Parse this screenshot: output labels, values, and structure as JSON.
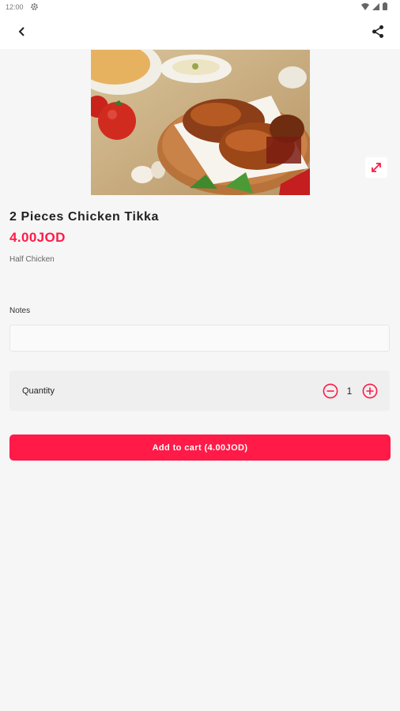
{
  "status_bar": {
    "time": "12:00",
    "icons": [
      "gear-icon",
      "wifi-icon",
      "signal-icon",
      "battery-icon"
    ]
  },
  "app_bar": {
    "back_icon": "chevron-left-icon",
    "share_icon": "share-icon"
  },
  "product": {
    "image_icon": "food-photo",
    "expand_icon": "expand-icon",
    "title": "2 Pieces Chicken Tikka",
    "price": "4.00JOD",
    "description": "Half Chicken"
  },
  "notes": {
    "label": "Notes",
    "value": ""
  },
  "quantity": {
    "label": "Quantity",
    "value": "1",
    "minus_icon": "minus-circle-icon",
    "plus_icon": "plus-circle-icon"
  },
  "cart": {
    "button_label": "Add to cart (4.00JOD)"
  },
  "colors": {
    "accent": "#ff1a47",
    "background": "#f6f6f6"
  }
}
